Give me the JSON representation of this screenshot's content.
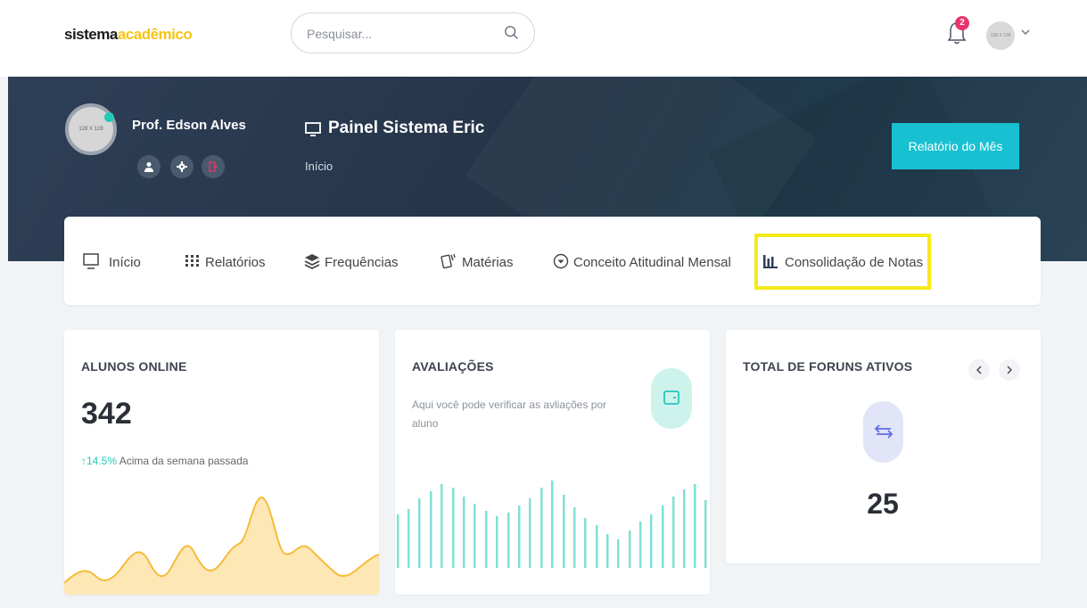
{
  "header": {
    "logo_part1": "sistema",
    "logo_part2": "acadêmico",
    "search_placeholder": "Pesquisar...",
    "notification_count": "2",
    "avatar_text": "128 X 128"
  },
  "profile": {
    "avatar_text": "128 X 128",
    "name": "Prof. Edson Alves",
    "online": true
  },
  "panel": {
    "title": "Painel Sistema Eric",
    "breadcrumb": "Início",
    "report_button": "Relatório do Mês"
  },
  "nav": {
    "items": [
      {
        "label": "Início",
        "icon": "monitor-icon"
      },
      {
        "label": "Relatórios",
        "icon": "grid-icon"
      },
      {
        "label": "Frequências",
        "icon": "layers-icon"
      },
      {
        "label": "Matérias",
        "icon": "cards-icon"
      },
      {
        "label": "Conceito Atitudinal Mensal",
        "icon": "chevron-circle-icon"
      },
      {
        "label": "Consolidação de Notas",
        "icon": "bar-chart-icon"
      }
    ],
    "highlighted": "Consolidação de Notas"
  },
  "cards": {
    "online": {
      "title": "ALUNOS ONLINE",
      "value": "342",
      "delta": "14.5%",
      "delta_text": "Acima da semana passada"
    },
    "avaliacoes": {
      "title": "AVALIAÇÕES",
      "description": "Aqui você pode verificar as avliações por aluno"
    },
    "foruns": {
      "title": "TOTAL DE FORUNS ATIVOS",
      "value": "25"
    }
  },
  "colors": {
    "accent": "#17c1d2",
    "teal": "#23c9b7",
    "badge": "#e8336b",
    "highlight": "#f4ea1c",
    "area": "#f7bb3b",
    "bars": "#7fe0d3"
  }
}
